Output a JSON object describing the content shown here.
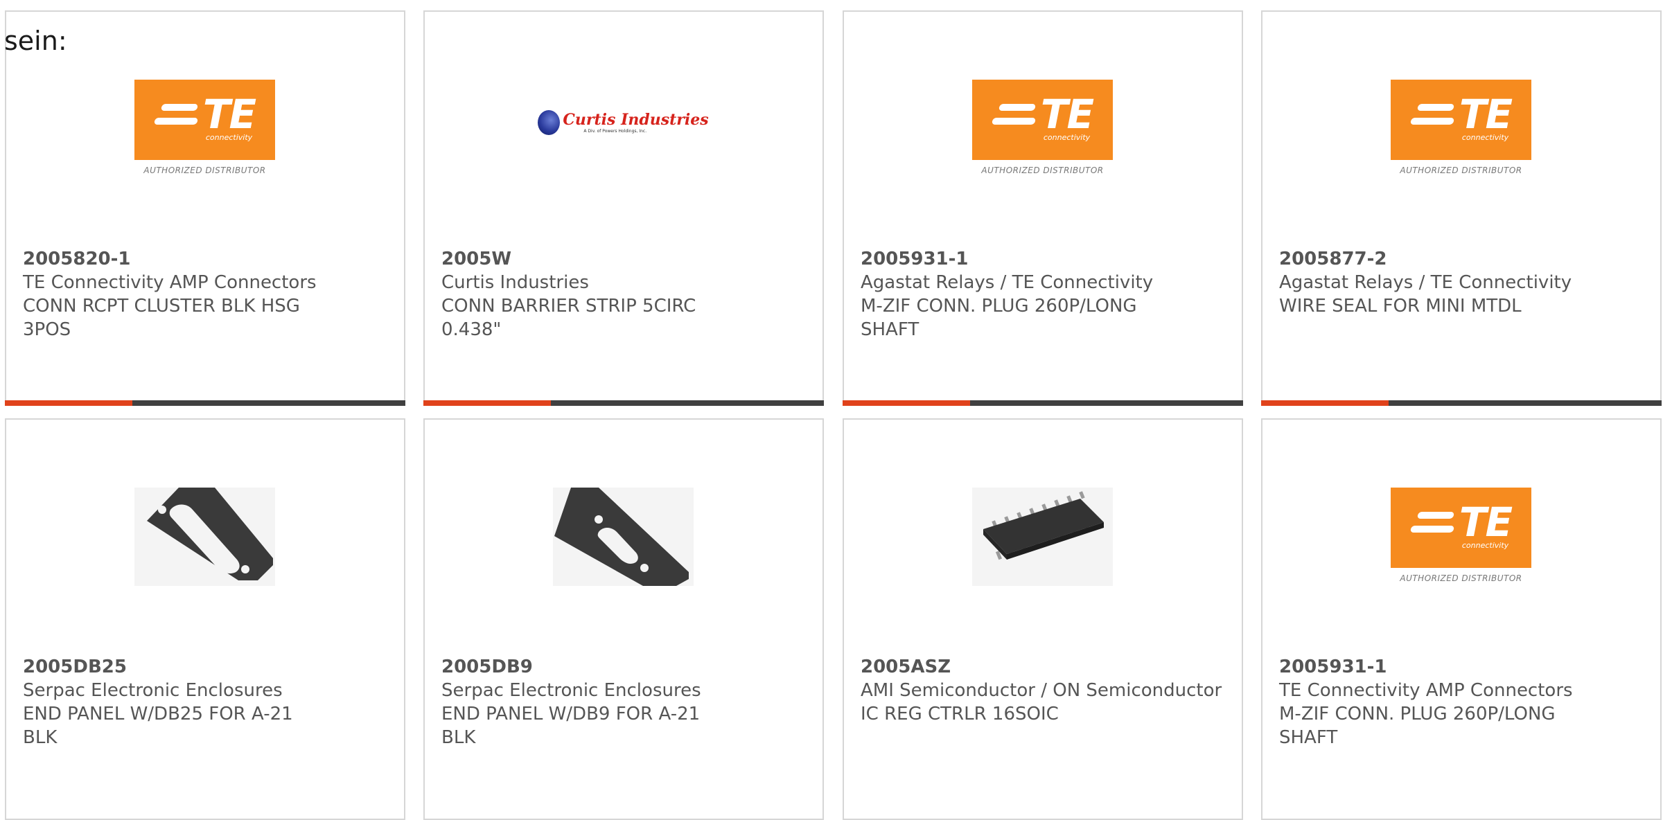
{
  "leading_text": "sein:",
  "colors": {
    "te_orange": "#f68b1f",
    "curtis_red": "#d6231c",
    "card_bar_accent": "#e0421b",
    "card_bar_rest": "#404040",
    "text_gray": "#555555"
  },
  "products": [
    {
      "part_number": "2005820-1",
      "manufacturer": "TE Connectivity AMP Connectors",
      "description": "CONN RCPT CLUSTER BLK HSG 3POS",
      "image_icon": "te-connectivity-logo",
      "logo_letters": "TE",
      "logo_subtext": "connectivity",
      "logo_tagline": "AUTHORIZED DISTRIBUTOR"
    },
    {
      "part_number": "2005W",
      "manufacturer": "Curtis Industries",
      "description": "CONN BARRIER STRIP 5CIRC 0.438\"",
      "image_icon": "curtis-industries-logo",
      "logo_name": "Curtis Industries",
      "logo_subtext": "A Div. of Powers Holdings, Inc."
    },
    {
      "part_number": "2005931-1",
      "manufacturer": "Agastat Relays / TE Connectivity",
      "description": "M-ZIF CONN. PLUG 260P/LONG SHAFT",
      "image_icon": "te-connectivity-logo",
      "logo_letters": "TE",
      "logo_subtext": "connectivity",
      "logo_tagline": "AUTHORIZED DISTRIBUTOR"
    },
    {
      "part_number": "2005877-2",
      "manufacturer": "Agastat Relays / TE Connectivity",
      "description": "WIRE SEAL FOR MINI MTDL",
      "image_icon": "te-connectivity-logo",
      "logo_letters": "TE",
      "logo_subtext": "connectivity",
      "logo_tagline": "AUTHORIZED DISTRIBUTOR"
    },
    {
      "part_number": "2005DB25",
      "manufacturer": "Serpac Electronic Enclosures",
      "description": "END PANEL W/DB25 FOR A-21 BLK",
      "image_icon": "db25-end-panel-image"
    },
    {
      "part_number": "2005DB9",
      "manufacturer": "Serpac Electronic Enclosures",
      "description": "END PANEL W/DB9 FOR A-21 BLK",
      "image_icon": "db9-end-panel-image"
    },
    {
      "part_number": "2005ASZ",
      "manufacturer": "AMI Semiconductor / ON Semiconductor",
      "description": "IC REG CTRLR 16SOIC",
      "image_icon": "soic16-chip-image"
    },
    {
      "part_number": "2005931-1",
      "manufacturer": "TE Connectivity AMP Connectors",
      "description": "M-ZIF CONN. PLUG 260P/LONG SHAFT",
      "image_icon": "te-connectivity-logo",
      "logo_letters": "TE",
      "logo_subtext": "connectivity",
      "logo_tagline": "AUTHORIZED DISTRIBUTOR"
    }
  ]
}
